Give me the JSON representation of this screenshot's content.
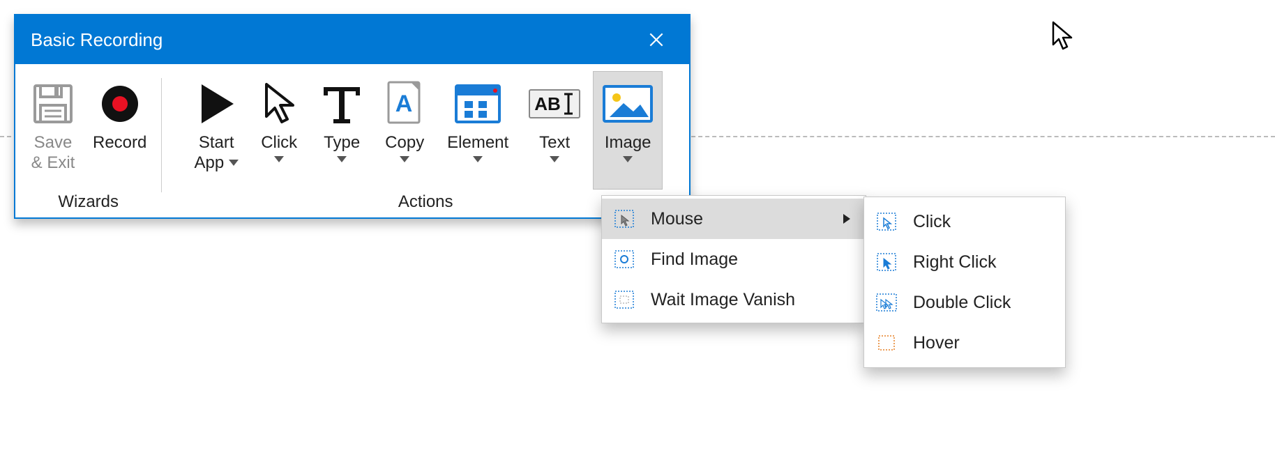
{
  "window": {
    "title": "Basic Recording"
  },
  "groups": {
    "wizards": {
      "label": "Wizards",
      "save_line1": "Save",
      "save_line2": "& Exit",
      "record": "Record"
    },
    "actions": {
      "label": "Actions",
      "start_app_line1": "Start",
      "start_app_line2": "App",
      "click": "Click",
      "type": "Type",
      "copy": "Copy",
      "element": "Element",
      "text": "Text",
      "image": "Image"
    }
  },
  "image_menu": {
    "mouse": "Mouse",
    "find_image": "Find Image",
    "wait_vanish": "Wait Image Vanish"
  },
  "mouse_menu": {
    "click": "Click",
    "right_click": "Right Click",
    "double_click": "Double Click",
    "hover": "Hover"
  }
}
